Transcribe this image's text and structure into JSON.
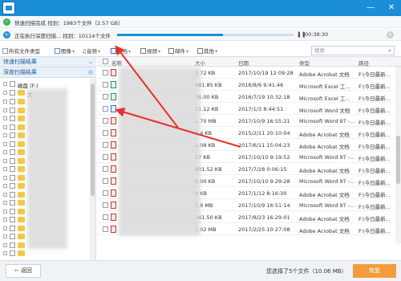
{
  "window": {
    "minimize": "—",
    "close": "✕"
  },
  "progress": {
    "row1_text": "快速扫描完成  找到：1983个文件（2.57 GB）",
    "row2_text": "正在执行深度扫描...  找到：10114个文件",
    "elapsed": "00:38:30",
    "deep_scan_fraction": 0.6
  },
  "filters": {
    "all": "所有文件类型",
    "image": "图像",
    "audio": "音频",
    "doc": "文档",
    "video": "视频",
    "mail": "邮件",
    "other": "其他",
    "search_placeholder": "搜索"
  },
  "left": {
    "quick": "快速扫描结果",
    "deep": "深度扫描结果",
    "root_label": "磁盘 (F:)",
    "first_item": "文"
  },
  "table": {
    "headers": {
      "name": "名称",
      "size": "大小",
      "date": "日期",
      "type": "类型",
      "path": "路径"
    },
    "rows": [
      {
        "kind": "pdf",
        "size": "3.72 KB",
        "date": "2017/10/19 12:09:28",
        "type": "Adobe Acrobat 文档",
        "path": "F:\\今日最新..."
      },
      {
        "kind": "xls",
        "size": "981.85 KB",
        "date": "2016/8/6 9:41:46",
        "type": "Microsoft Excel 工...",
        "path": "F:\\今日最新..."
      },
      {
        "kind": "xls",
        "size": "36.00 KB",
        "date": "2016/7/19 10:32:18",
        "type": "Microsoft Excel 工...",
        "path": "F:\\今日最新..."
      },
      {
        "kind": "doc",
        "size": "11.12 KB",
        "date": "2017/1/3 8:44:51",
        "type": "Microsoft Word 文档",
        "path": "F:\\今日最新..."
      },
      {
        "kind": "pdf",
        "size": "1.70 MB",
        "date": "2017/10/9 16:55:21",
        "type": "Microsoft Word 97 -...",
        "path": "F:\\今日最新..."
      },
      {
        "kind": "pdf",
        "size": "3.4 KB",
        "date": "2015/2/11 20:10:04",
        "type": "Adobe Acrobat 文档",
        "path": "F:\\今日最新..."
      },
      {
        "kind": "pdf",
        "size": "1.08 KB",
        "date": "2017/6/11 15:04:23",
        "type": "Adobe Acrobat 文档",
        "path": "F:\\今日最新..."
      },
      {
        "kind": "pdf",
        "size": "57 KB",
        "date": "2017/10/10 9:19:52",
        "type": "Microsoft Word 97 -...",
        "path": "F:\\今日最新..."
      },
      {
        "kind": "pdf",
        "size": "801.52 KB",
        "date": "2017/7/28 0:06:15",
        "type": "Adobe Acrobat 文档",
        "path": "F:\\今日最新..."
      },
      {
        "kind": "pdf",
        "size": "8.00 KB",
        "date": "2017/10/10 9:29:28",
        "type": "Microsoft Word 97 -...",
        "path": "F:\\今日最新..."
      },
      {
        "kind": "pdf",
        "size": "9 KB",
        "date": "2017/1/12 8:16:30",
        "type": "Adobe Acrobat 文档",
        "path": "F:\\今日最新..."
      },
      {
        "kind": "pdf",
        "size": "1.8 MB",
        "date": "2017/10/9 16:51:14",
        "type": "Microsoft Word 97 -...",
        "path": "F:\\今日最新..."
      },
      {
        "kind": "pdf",
        "size": "341.50 KB",
        "date": "2017/8/23 16:29:01",
        "type": "Adobe Acrobat 文档",
        "path": "F:\\今日最新..."
      },
      {
        "kind": "pdf",
        "size": "1.02 MB",
        "date": "2017/2/25 10:27:08",
        "type": "Adobe Acrobat 文档",
        "path": "F:\\今日最新..."
      }
    ]
  },
  "bottom": {
    "back": "返回",
    "selected": "您选择了5个文件（10.06 MB）",
    "recover": "恢复"
  },
  "colors": {
    "accent": "#1a8fd8",
    "annotation": "#e8302a",
    "recover": "#f39c3b"
  }
}
